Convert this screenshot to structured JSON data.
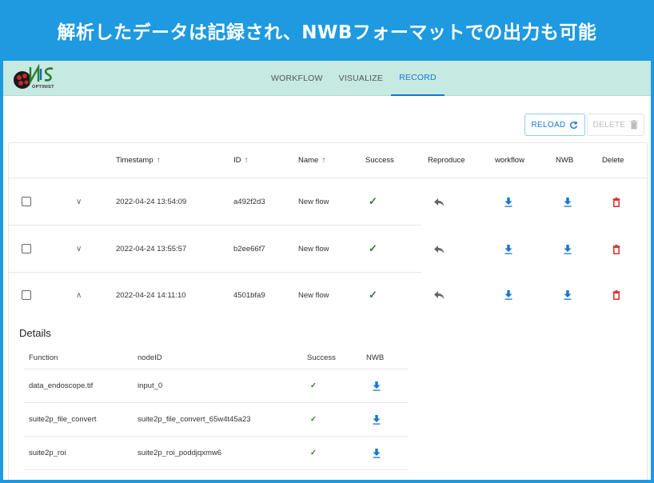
{
  "banner": {
    "text": "解析したデータは記録され、NWBフォーマットでの出力も可能"
  },
  "brand": {
    "logo_text": "OPTINIST"
  },
  "nav": {
    "tabs": [
      {
        "label": "WORKFLOW"
      },
      {
        "label": "VISUALIZE"
      },
      {
        "label": "RECORD",
        "active": true
      }
    ]
  },
  "toolbar": {
    "reload_label": "RELOAD",
    "delete_label": "DELETE"
  },
  "table": {
    "headers": {
      "timestamp": "Timestamp",
      "id": "ID",
      "name": "Name",
      "success": "Success",
      "reproduce": "Reproduce",
      "workflow": "workflow",
      "nwb": "NWB",
      "delete": "Delete"
    },
    "sort_glyph": "↑",
    "rows": [
      {
        "timestamp": "2022-04-24 13:54:09",
        "id": "a492f2d3",
        "name": "New flow",
        "success": "✓",
        "expanded": false
      },
      {
        "timestamp": "2022-04-24 13:55:57",
        "id": "b2ee66f7",
        "name": "New flow",
        "success": "✓",
        "expanded": false
      },
      {
        "timestamp": "2022-04-24 14:11:10",
        "id": "4501bfa9",
        "name": "New flow",
        "success": "✓",
        "expanded": true
      }
    ]
  },
  "details": {
    "title": "Details",
    "headers": {
      "function": "Function",
      "node_id": "nodeID",
      "success": "Success",
      "nwb": "NWB"
    },
    "rows": [
      {
        "function": "data_endoscope.tif",
        "node_id": "input_0",
        "success": "✓"
      },
      {
        "function": "suite2p_file_convert",
        "node_id": "suite2p_file_convert_65w4t45a23",
        "success": "✓"
      },
      {
        "function": "suite2p_roi",
        "node_id": "suite2p_roi_poddjqxmw6",
        "success": "✓"
      }
    ]
  },
  "colors": {
    "banner_bg": "#1e9ae0",
    "appbar_bg": "#c6e9e2",
    "accent": "#1976d2",
    "success": "#2e7d32",
    "danger": "#d32f2f"
  },
  "icons": {
    "chevron_collapsed": "∨",
    "chevron_expanded": "∧",
    "reproduce": "reply-icon",
    "download": "download-icon",
    "delete": "trash-icon",
    "reload": "refresh-icon"
  }
}
